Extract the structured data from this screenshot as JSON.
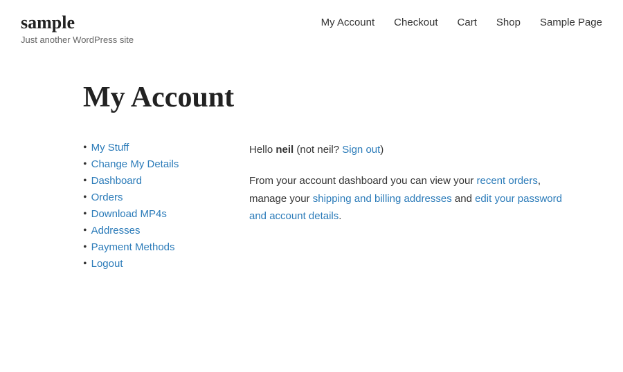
{
  "site": {
    "title": "sample",
    "tagline": "Just another WordPress site"
  },
  "nav": {
    "links": [
      {
        "label": "My Account",
        "active": true
      },
      {
        "label": "Checkout",
        "active": false
      },
      {
        "label": "Cart",
        "active": false
      },
      {
        "label": "Shop",
        "active": false
      },
      {
        "label": "Sample Page",
        "active": false
      }
    ]
  },
  "page": {
    "title": "My Account"
  },
  "sidebar": {
    "items": [
      {
        "label": "My Stuff"
      },
      {
        "label": "Change My Details"
      },
      {
        "label": "Dashboard"
      },
      {
        "label": "Orders"
      },
      {
        "label": "Download MP4s"
      },
      {
        "label": "Addresses"
      },
      {
        "label": "Payment Methods"
      },
      {
        "label": "Logout"
      }
    ]
  },
  "content": {
    "hello_prefix": "Hello ",
    "hello_user": "neil",
    "hello_middle": " (not neil? ",
    "hello_sign_out": "Sign out",
    "hello_suffix": ")",
    "dashboard_prefix": "From your account dashboard you can view your ",
    "dashboard_link1": "recent orders",
    "dashboard_middle": ", manage your ",
    "dashboard_link2": "shipping and billing addresses",
    "dashboard_and": " and ",
    "dashboard_link3": "edit your password and account details",
    "dashboard_suffix": "."
  }
}
